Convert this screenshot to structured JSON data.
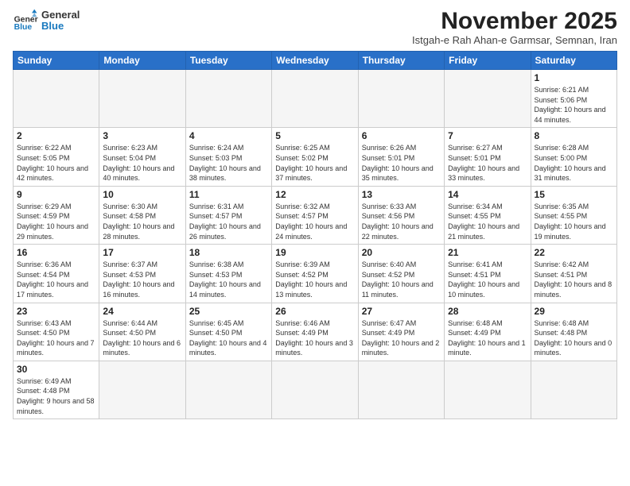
{
  "logo": {
    "text_general": "General",
    "text_blue": "Blue"
  },
  "header": {
    "month": "November 2025",
    "location": "Istgah-e Rah Ahan-e Garmsar, Semnan, Iran"
  },
  "weekdays": [
    "Sunday",
    "Monday",
    "Tuesday",
    "Wednesday",
    "Thursday",
    "Friday",
    "Saturday"
  ],
  "weeks": [
    [
      {
        "day": "",
        "info": ""
      },
      {
        "day": "",
        "info": ""
      },
      {
        "day": "",
        "info": ""
      },
      {
        "day": "",
        "info": ""
      },
      {
        "day": "",
        "info": ""
      },
      {
        "day": "",
        "info": ""
      },
      {
        "day": "1",
        "info": "Sunrise: 6:21 AM\nSunset: 5:06 PM\nDaylight: 10 hours\nand 44 minutes."
      }
    ],
    [
      {
        "day": "2",
        "info": "Sunrise: 6:22 AM\nSunset: 5:05 PM\nDaylight: 10 hours\nand 42 minutes."
      },
      {
        "day": "3",
        "info": "Sunrise: 6:23 AM\nSunset: 5:04 PM\nDaylight: 10 hours\nand 40 minutes."
      },
      {
        "day": "4",
        "info": "Sunrise: 6:24 AM\nSunset: 5:03 PM\nDaylight: 10 hours\nand 38 minutes."
      },
      {
        "day": "5",
        "info": "Sunrise: 6:25 AM\nSunset: 5:02 PM\nDaylight: 10 hours\nand 37 minutes."
      },
      {
        "day": "6",
        "info": "Sunrise: 6:26 AM\nSunset: 5:01 PM\nDaylight: 10 hours\nand 35 minutes."
      },
      {
        "day": "7",
        "info": "Sunrise: 6:27 AM\nSunset: 5:01 PM\nDaylight: 10 hours\nand 33 minutes."
      },
      {
        "day": "8",
        "info": "Sunrise: 6:28 AM\nSunset: 5:00 PM\nDaylight: 10 hours\nand 31 minutes."
      }
    ],
    [
      {
        "day": "9",
        "info": "Sunrise: 6:29 AM\nSunset: 4:59 PM\nDaylight: 10 hours\nand 29 minutes."
      },
      {
        "day": "10",
        "info": "Sunrise: 6:30 AM\nSunset: 4:58 PM\nDaylight: 10 hours\nand 28 minutes."
      },
      {
        "day": "11",
        "info": "Sunrise: 6:31 AM\nSunset: 4:57 PM\nDaylight: 10 hours\nand 26 minutes."
      },
      {
        "day": "12",
        "info": "Sunrise: 6:32 AM\nSunset: 4:57 PM\nDaylight: 10 hours\nand 24 minutes."
      },
      {
        "day": "13",
        "info": "Sunrise: 6:33 AM\nSunset: 4:56 PM\nDaylight: 10 hours\nand 22 minutes."
      },
      {
        "day": "14",
        "info": "Sunrise: 6:34 AM\nSunset: 4:55 PM\nDaylight: 10 hours\nand 21 minutes."
      },
      {
        "day": "15",
        "info": "Sunrise: 6:35 AM\nSunset: 4:55 PM\nDaylight: 10 hours\nand 19 minutes."
      }
    ],
    [
      {
        "day": "16",
        "info": "Sunrise: 6:36 AM\nSunset: 4:54 PM\nDaylight: 10 hours\nand 17 minutes."
      },
      {
        "day": "17",
        "info": "Sunrise: 6:37 AM\nSunset: 4:53 PM\nDaylight: 10 hours\nand 16 minutes."
      },
      {
        "day": "18",
        "info": "Sunrise: 6:38 AM\nSunset: 4:53 PM\nDaylight: 10 hours\nand 14 minutes."
      },
      {
        "day": "19",
        "info": "Sunrise: 6:39 AM\nSunset: 4:52 PM\nDaylight: 10 hours\nand 13 minutes."
      },
      {
        "day": "20",
        "info": "Sunrise: 6:40 AM\nSunset: 4:52 PM\nDaylight: 10 hours\nand 11 minutes."
      },
      {
        "day": "21",
        "info": "Sunrise: 6:41 AM\nSunset: 4:51 PM\nDaylight: 10 hours\nand 10 minutes."
      },
      {
        "day": "22",
        "info": "Sunrise: 6:42 AM\nSunset: 4:51 PM\nDaylight: 10 hours\nand 8 minutes."
      }
    ],
    [
      {
        "day": "23",
        "info": "Sunrise: 6:43 AM\nSunset: 4:50 PM\nDaylight: 10 hours\nand 7 minutes."
      },
      {
        "day": "24",
        "info": "Sunrise: 6:44 AM\nSunset: 4:50 PM\nDaylight: 10 hours\nand 6 minutes."
      },
      {
        "day": "25",
        "info": "Sunrise: 6:45 AM\nSunset: 4:50 PM\nDaylight: 10 hours\nand 4 minutes."
      },
      {
        "day": "26",
        "info": "Sunrise: 6:46 AM\nSunset: 4:49 PM\nDaylight: 10 hours\nand 3 minutes."
      },
      {
        "day": "27",
        "info": "Sunrise: 6:47 AM\nSunset: 4:49 PM\nDaylight: 10 hours\nand 2 minutes."
      },
      {
        "day": "28",
        "info": "Sunrise: 6:48 AM\nSunset: 4:49 PM\nDaylight: 10 hours\nand 1 minute."
      },
      {
        "day": "29",
        "info": "Sunrise: 6:48 AM\nSunset: 4:48 PM\nDaylight: 10 hours\nand 0 minutes."
      }
    ],
    [
      {
        "day": "30",
        "info": "Sunrise: 6:49 AM\nSunset: 4:48 PM\nDaylight: 9 hours\nand 58 minutes."
      },
      {
        "day": "",
        "info": ""
      },
      {
        "day": "",
        "info": ""
      },
      {
        "day": "",
        "info": ""
      },
      {
        "day": "",
        "info": ""
      },
      {
        "day": "",
        "info": ""
      },
      {
        "day": "",
        "info": ""
      }
    ]
  ]
}
